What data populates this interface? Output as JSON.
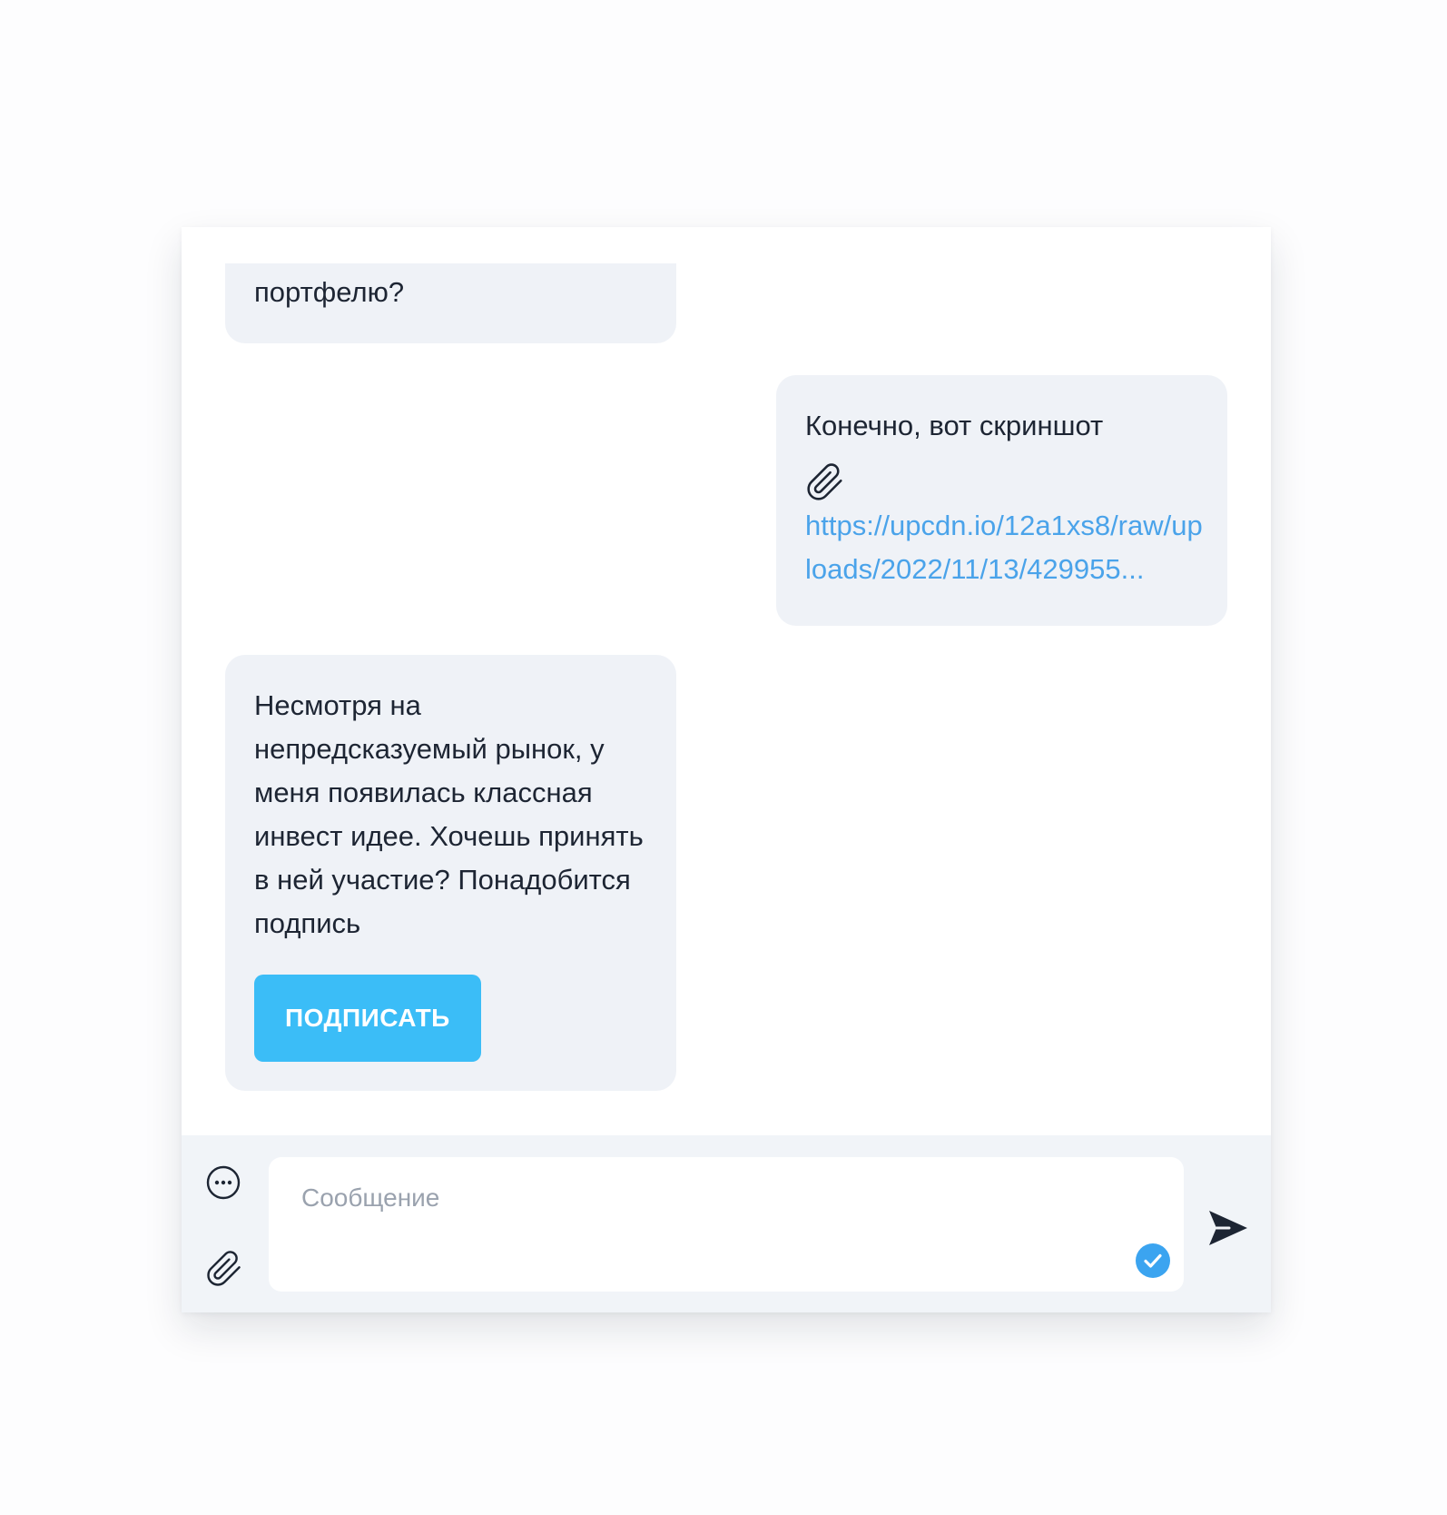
{
  "messages": [
    {
      "side": "left",
      "text": "портфелю?"
    },
    {
      "side": "right",
      "text": "Конечно, вот скриншот",
      "attachment_icon": "paperclip-icon",
      "link_text": "https://upcdn.io/12a1xs8/raw/uploads/2022/11/13/429955..."
    },
    {
      "side": "left",
      "text": "Несмотря на непредсказуемый рынок, у меня появилась классная инвест идее. Хочешь принять в ней участие? Понадобится подпись",
      "button_label": "ПОДПИСАТЬ"
    }
  ],
  "composer": {
    "placeholder": "Сообщение",
    "value": "",
    "menu_icon": "more-horizontal-circle-icon",
    "attach_icon": "paperclip-icon",
    "check_icon": "check-circle-icon",
    "send_icon": "send-icon"
  },
  "colors": {
    "bubble_bg": "#eff2f7",
    "link": "#4aa3ea",
    "button": "#3bbdf7",
    "composer_bg": "#f1f4f8",
    "check": "#3ba4f0",
    "send": "#1d2533"
  }
}
